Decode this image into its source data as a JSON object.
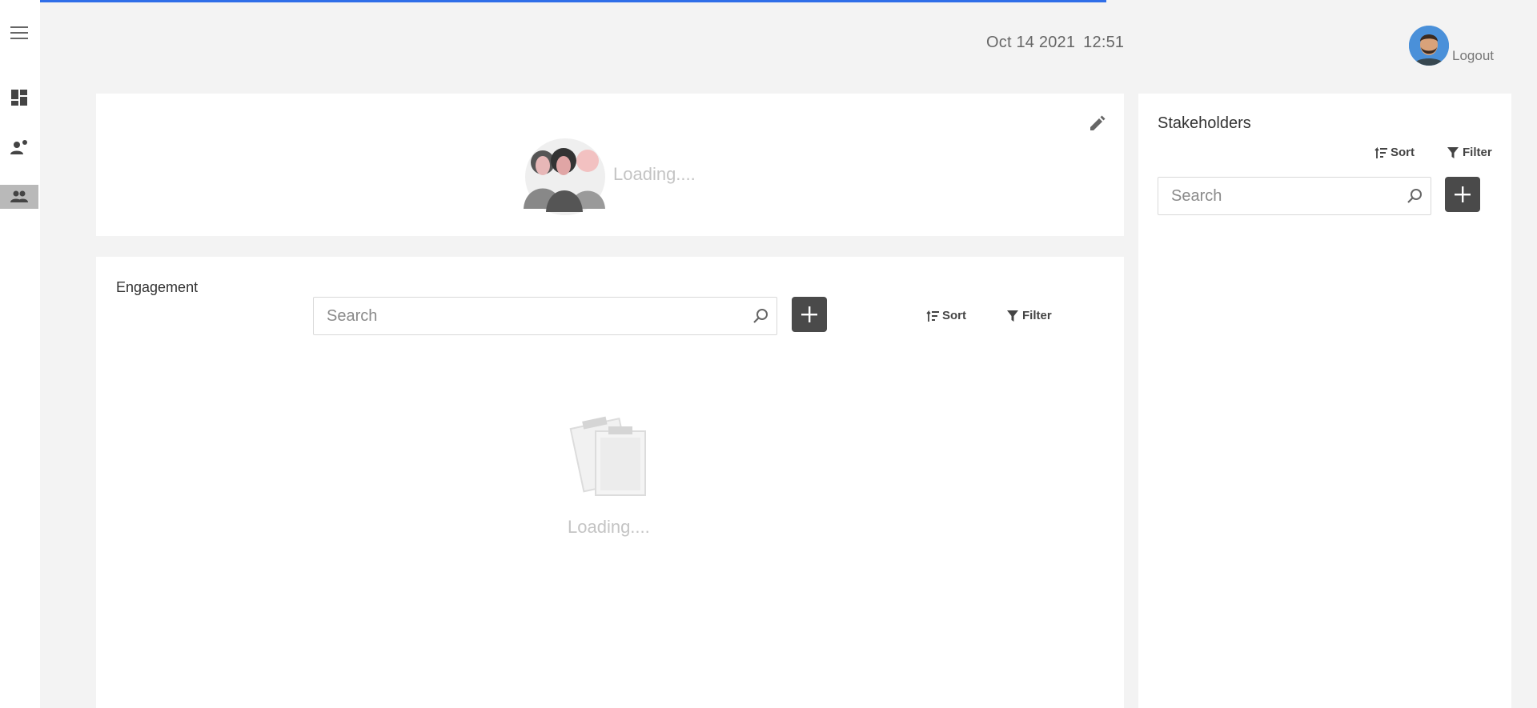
{
  "header": {
    "date": "Oct 14 2021",
    "time": "12:51",
    "logout_label": "Logout"
  },
  "sidebar": {
    "items": [
      {
        "icon": "menu-icon"
      },
      {
        "icon": "dashboard-icon"
      },
      {
        "icon": "person-engagement-icon"
      },
      {
        "icon": "group-icon",
        "active": true
      }
    ]
  },
  "profile_card": {
    "loading_text": "Loading...."
  },
  "engagement": {
    "title": "Engagement",
    "search_placeholder": "Search",
    "sort_label": "Sort",
    "filter_label": "Filter",
    "loading_text": "Loading...."
  },
  "stakeholders": {
    "title": "Stakeholders",
    "search_placeholder": "Search",
    "sort_label": "Sort",
    "filter_label": "Filter"
  },
  "colors": {
    "progress": "#2f6ee8",
    "add_button": "#4a4a4a",
    "background": "#f3f3f3"
  },
  "progress": {
    "percent": 72
  }
}
